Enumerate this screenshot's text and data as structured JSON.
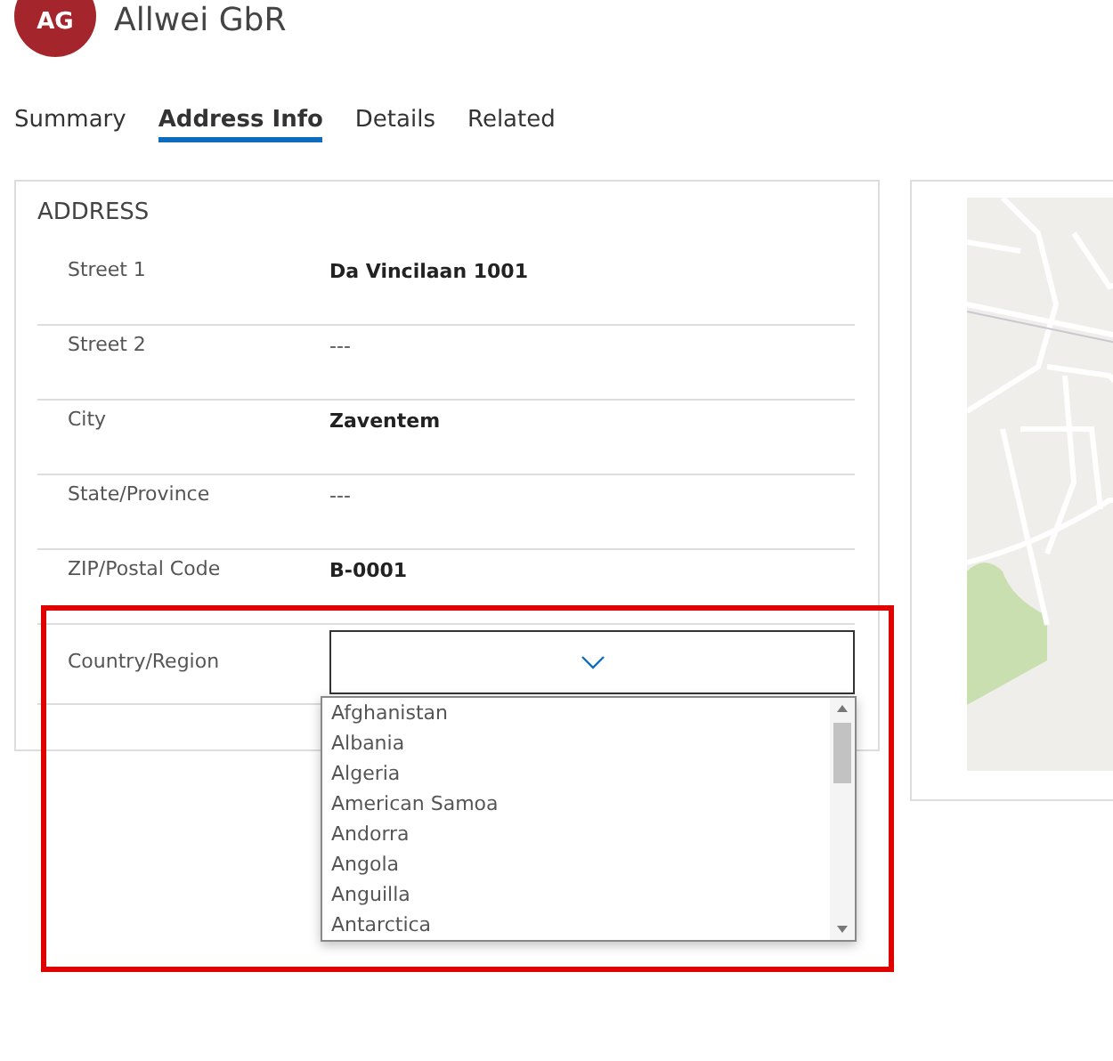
{
  "header": {
    "avatar_initials": "AG",
    "title": "Allwei GbR"
  },
  "tabs": [
    {
      "label": "Summary",
      "selected": false
    },
    {
      "label": "Address Info",
      "selected": true
    },
    {
      "label": "Details",
      "selected": false
    },
    {
      "label": "Related",
      "selected": false
    }
  ],
  "address": {
    "heading": "ADDRESS",
    "fields": [
      {
        "label": "Street 1",
        "value": "Da Vincilaan 1001"
      },
      {
        "label": "Street 2",
        "value": "---"
      },
      {
        "label": "City",
        "value": "Zaventem"
      },
      {
        "label": "State/Province",
        "value": "---"
      },
      {
        "label": "ZIP/Postal Code",
        "value": "B-0001"
      }
    ],
    "country": {
      "label": "Country/Region",
      "expanded": true,
      "options": [
        "Afghanistan",
        "Albania",
        "Algeria",
        "American Samoa",
        "Andorra",
        "Angola",
        "Anguilla",
        "Antarctica"
      ]
    }
  }
}
